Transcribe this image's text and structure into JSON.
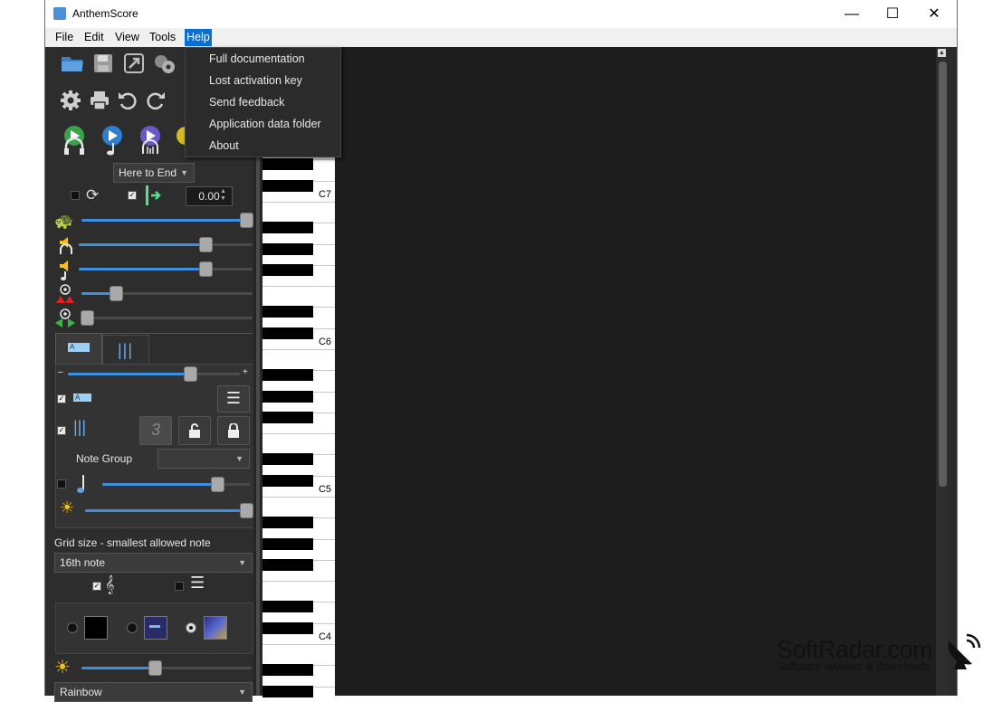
{
  "window": {
    "title": "AnthemScore",
    "minimize": "—",
    "maximize": "☐",
    "close": "✕"
  },
  "menubar": {
    "items": [
      "File",
      "Edit",
      "View",
      "Tools",
      "Help"
    ],
    "active": "Help"
  },
  "help_menu": {
    "items": [
      "Full documentation",
      "Lost activation key",
      "Send feedback",
      "Application data folder",
      "About"
    ]
  },
  "toolbar": {
    "row1": [
      "open-folder-icon",
      "save-icon",
      "export-icon",
      "gear-icon"
    ],
    "row2": [
      "settings-icon",
      "print-icon",
      "undo-icon",
      "redo-icon"
    ],
    "row3": [
      "play-headphones-icon",
      "play-note-icon",
      "play-audio-icon",
      "metronome-icon"
    ]
  },
  "playback": {
    "range": "Here to End",
    "position": "0.00"
  },
  "sliders": {
    "speed": 1.0,
    "headphone_volume": 0.73,
    "note_volume": 0.73,
    "vertical_zoom": 0.2,
    "horizontal_zoom": 0.03,
    "text_size": 0.71,
    "note_length": 0.78,
    "brightness_top": 0.98,
    "brightness_bottom": 0.43
  },
  "tabs": [
    "tab-notes",
    "tab-bars"
  ],
  "zoom": {
    "minus": "–",
    "plus": "+"
  },
  "labels": {
    "note_group": "Note Group",
    "grid_size": "Grid size - smallest allowed note",
    "grid_value": "16th note",
    "tuplet": "3",
    "colormap": "Rainbow"
  },
  "piano": {
    "labels": [
      "C7",
      "C6",
      "C5",
      "C4"
    ]
  },
  "watermark": {
    "brand": "SoftRadar.com",
    "tagline": "Software reviews & downloads"
  },
  "colors": {
    "accent": "#3d8fe0",
    "menu_active": "#0a6fd3",
    "panel": "#2d2d2d",
    "main": "#1d1d1d"
  }
}
